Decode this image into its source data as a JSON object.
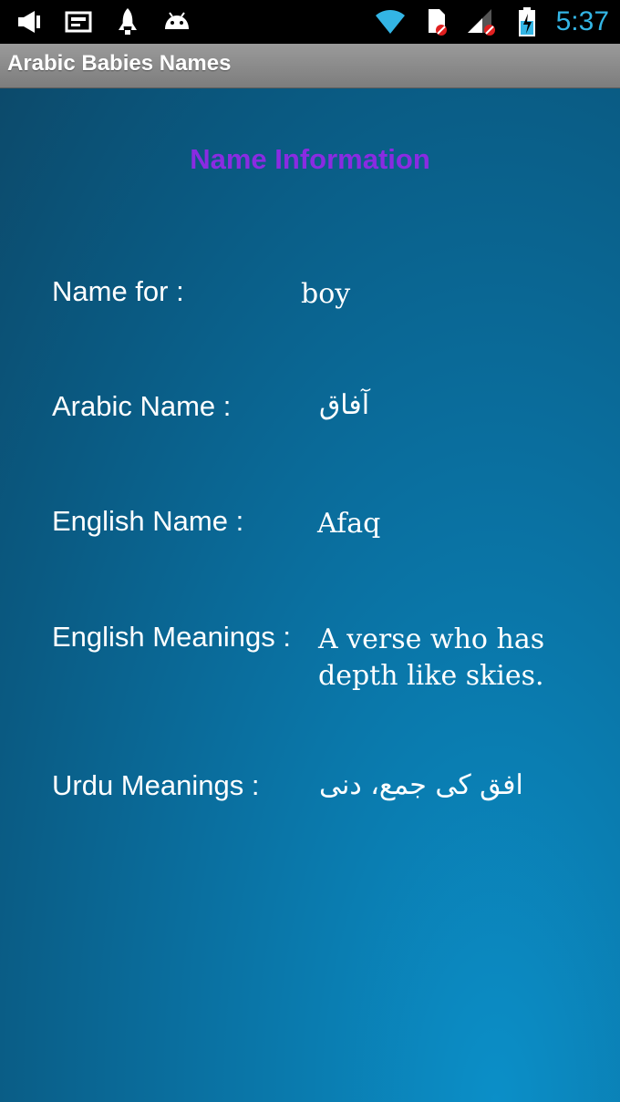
{
  "status_bar": {
    "left_icons": [
      "megaphone-icon",
      "media-icon",
      "rocket-icon",
      "android-icon"
    ],
    "right_icons": [
      "wifi-icon",
      "sd-card-icon",
      "signal-icon",
      "battery-icon"
    ],
    "time": "5:37"
  },
  "action_bar": {
    "title": "Arabic Babies Names"
  },
  "page": {
    "heading": "Name Information",
    "fields": {
      "name_for": {
        "label": "Name for :",
        "value": "boy"
      },
      "arabic_name": {
        "label": "Arabic Name :",
        "value": "آفاق"
      },
      "english_name": {
        "label": "English Name :",
        "value": "Afaq"
      },
      "english_meanings": {
        "label": "English Meanings :",
        "value_line1": "A verse who has",
        "value_line2": "depth like skies."
      },
      "urdu_meanings": {
        "label": "Urdu Meanings :",
        "value": "افق کی جمع، دنی"
      }
    }
  },
  "colors": {
    "heading": "#8a2be2",
    "clock": "#33b5e5",
    "background_top": "#0c4a6b",
    "background_bottom": "#0b8fc8"
  }
}
